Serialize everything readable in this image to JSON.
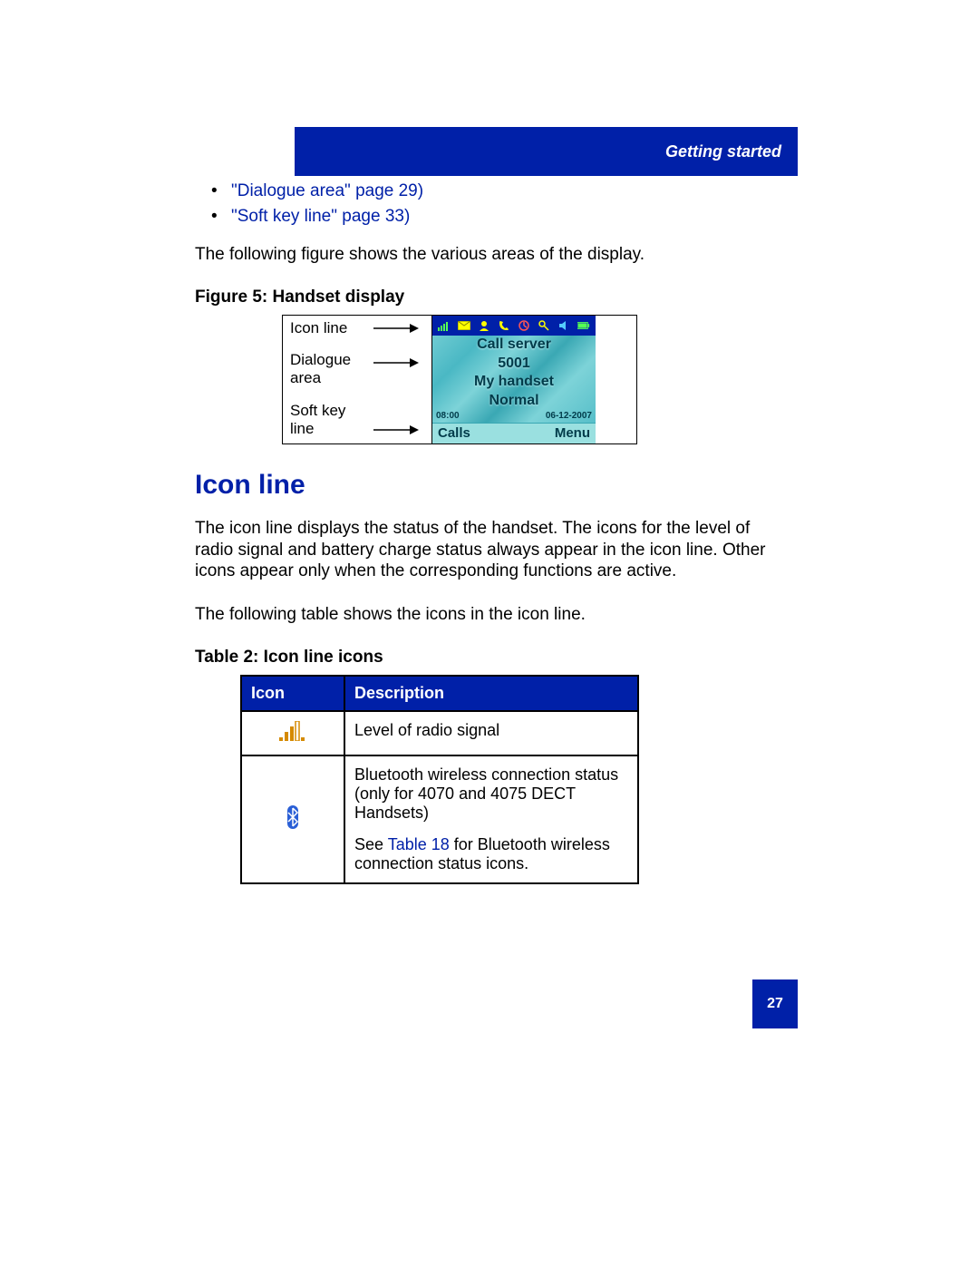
{
  "header": {
    "section_title": "Getting started"
  },
  "bullets": [
    "\"Dialogue area\" page 29)",
    "\"Soft key line\" page 33)"
  ],
  "intro_text": "The following figure shows the various areas of the display.",
  "figure": {
    "caption": "Figure 5: Handset display",
    "labels": {
      "icon_line": "Icon line",
      "dialogue_area_1": "Dialogue",
      "dialogue_area_2": "area",
      "soft_key_1": "Soft key",
      "soft_key_2": "line"
    },
    "dialogue_text": {
      "line1": "Call server",
      "line2": "5001",
      "line3": "My handset",
      "line4": "Normal"
    },
    "time": "08:00",
    "date": "06-12-2007",
    "softkeys": {
      "left": "Calls",
      "right": "Menu"
    }
  },
  "section": {
    "heading": "Icon line",
    "paragraph1": "The icon line displays the status of the handset. The icons for the level of radio signal and battery charge status always appear in the icon line. Other icons appear only when the corresponding functions are active.",
    "paragraph2": "The following table shows the icons in the icon line.",
    "table_caption": "Table 2: Icon line icons",
    "table_headers": {
      "col1": "Icon",
      "col2": "Description"
    },
    "table_rows": [
      {
        "icon_name": "signal-icon",
        "description": "Level of radio signal"
      },
      {
        "icon_name": "bluetooth-icon",
        "description_part1": "Bluetooth wireless connection status (only for 4070 and 4075 DECT Handsets)",
        "description_see": "See ",
        "description_link": "Table 18",
        "description_tail": " for Bluetooth wireless connection status icons."
      }
    ]
  },
  "page_number": "27"
}
